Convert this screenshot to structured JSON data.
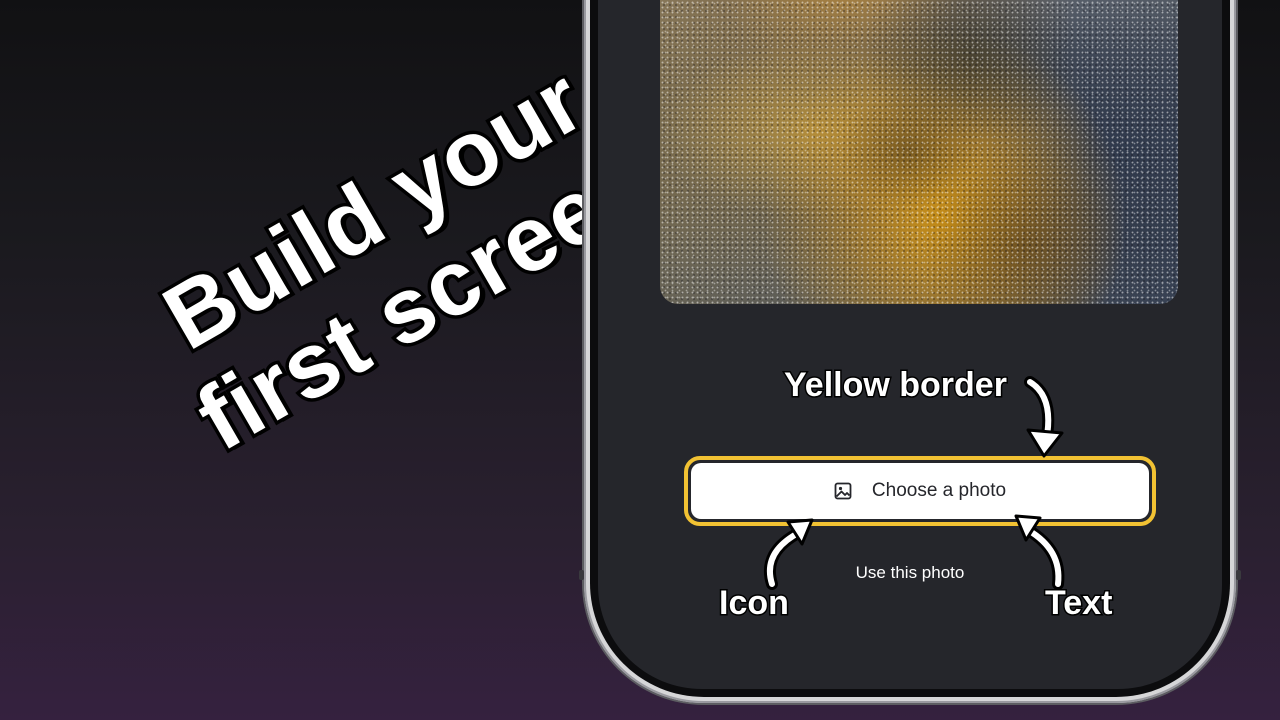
{
  "title": {
    "line1": "Build your",
    "line2": "first screen"
  },
  "button": {
    "label": "Choose a photo",
    "icon": "image-icon",
    "border_color": "#f2c233"
  },
  "secondary_link": {
    "label": "Use this photo"
  },
  "annotations": {
    "border": "Yellow border",
    "icon": "Icon",
    "text": "Text"
  },
  "colors": {
    "screen_bg": "#25262b",
    "accent": "#f2c233"
  }
}
